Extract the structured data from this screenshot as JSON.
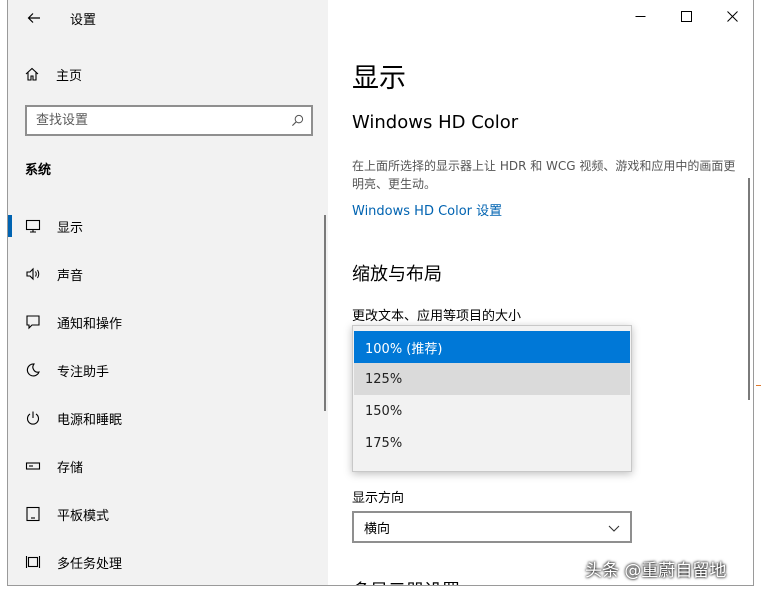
{
  "window": {
    "title": "设置"
  },
  "nav": {
    "home_label": "主页",
    "search_placeholder": "查找设置",
    "section_title": "系统",
    "items": [
      {
        "label": "显示",
        "icon": "monitor-icon",
        "active": true
      },
      {
        "label": "声音",
        "icon": "speaker-icon"
      },
      {
        "label": "通知和操作",
        "icon": "notification-icon"
      },
      {
        "label": "专注助手",
        "icon": "moon-icon"
      },
      {
        "label": "电源和睡眠",
        "icon": "power-icon"
      },
      {
        "label": "存储",
        "icon": "storage-icon"
      },
      {
        "label": "平板模式",
        "icon": "tablet-icon"
      },
      {
        "label": "多任务处理",
        "icon": "multitask-icon"
      }
    ]
  },
  "content": {
    "page_title": "显示",
    "hd_title": "Windows HD Color",
    "hd_desc": "在上面所选择的显示器上让 HDR 和 WCG 视频、游戏和应用中的画面更明亮、更生动。",
    "hd_link": "Windows HD Color 设置",
    "scale_title": "缩放与布局",
    "scale_label": "更改文本、应用等项目的大小",
    "scale_options": [
      "100% (推荐)",
      "125%",
      "150%",
      "175%"
    ],
    "orientation_label": "显示方向",
    "orientation_value": "横向",
    "partial_heading": "多显示器设置"
  },
  "watermark": "头条 @重蔚自留地",
  "colors": {
    "accent": "#0078d7",
    "link": "#0063b1",
    "nav_bg": "#f2f2f2"
  }
}
